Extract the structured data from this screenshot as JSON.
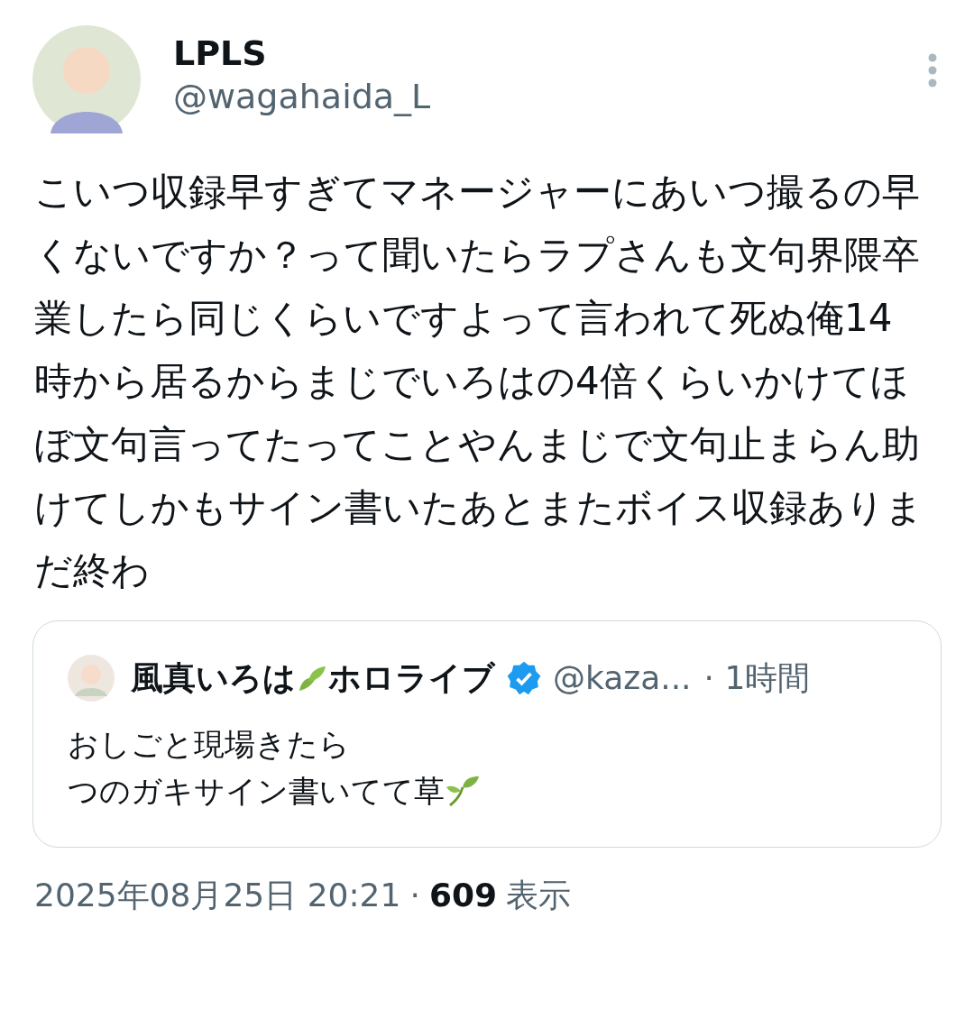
{
  "author": {
    "name": "LPLS",
    "handle": "@wagahaida_L"
  },
  "body": "こいつ収録早すぎてマネージャーにあいつ撮るの早くないですか？って聞いたらラプさんも文句界隈卒業したら同じくらいですよって言われて死ぬ俺14時から居るからまじでいろはの4倍くらいかけてほぼ文句言ってたってことやんまじで文句止まらん助けてしかもサイン書いたあとまたボイス収録ありまだ終わ",
  "quote": {
    "name_parts": [
      "風真いろは",
      "ホロライブ"
    ],
    "verified": true,
    "handle": "@kaza...",
    "time": "· 1時間",
    "lines": [
      "おしごと現場きたら",
      "つのガキサイン書いてて草"
    ]
  },
  "footer": {
    "timestamp": "2025年08月25日 20:21",
    "separator": "·",
    "views": "609",
    "views_label": "表示"
  }
}
